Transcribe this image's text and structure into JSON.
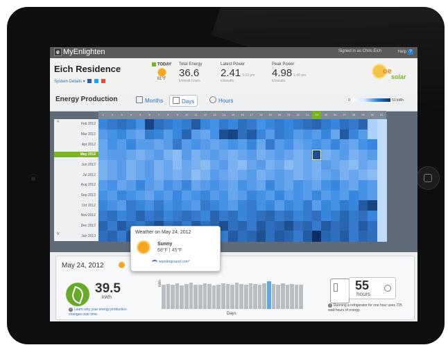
{
  "app": {
    "name": "MyEnlighten",
    "logo_glyph": "e",
    "signed_in": "Signed in as Chris Eich",
    "help_label": "Help"
  },
  "site": {
    "name": "Eich Residence",
    "details_link": "System Details"
  },
  "stats": {
    "today_label": "TODAY",
    "weather_temp": "81°F",
    "total_energy_label": "Total Energy",
    "total_energy_value": "36.6",
    "total_energy_unit": "kilowatt hours",
    "latest_power_label": "Latest Power",
    "latest_power_value": "2.41",
    "latest_power_time": "5:10 pm",
    "latest_power_unit": "kilowatts",
    "peak_power_label": "Peak Power",
    "peak_power_value": "4.98",
    "peak_power_time": "1:40 pm",
    "peak_power_unit": "kilowatts"
  },
  "brand": {
    "part1": "oe",
    "part2": "solar"
  },
  "production": {
    "title": "Energy Production",
    "tabs": [
      "Months",
      "Days",
      "Hours"
    ],
    "active_tab": 1,
    "legend_min": "0",
    "legend_max": "53 kWh",
    "colors": {
      "highlight": "#7ab51d",
      "low": "#cfe6ff",
      "high": "#0e2e63"
    }
  },
  "heatmap": {
    "days": [
      "1",
      "2",
      "3",
      "4",
      "5",
      "6",
      "7",
      "8",
      "9",
      "10",
      "11",
      "12",
      "13",
      "14",
      "15",
      "16",
      "17",
      "18",
      "19",
      "20",
      "21",
      "22",
      "23",
      "24",
      "25",
      "26",
      "27",
      "28",
      "29",
      "30",
      "31"
    ],
    "selected_day": 24,
    "months": [
      "Feb 2012",
      "Mar 2012",
      "Apr 2012",
      "May 2012",
      "Jun 2012",
      "Jul 2012",
      "Aug 2012",
      "Sep 2012",
      "Oct 2012",
      "Nov 2012",
      "Dec 2012",
      "Jan 2013"
    ],
    "selected_month": 3,
    "values": [
      [
        34,
        36,
        38,
        36,
        32,
        46,
        38,
        36,
        34,
        36,
        42,
        34,
        32,
        36,
        34,
        38,
        36,
        32,
        34,
        36,
        34,
        36,
        38,
        40,
        36,
        34,
        38,
        36,
        40,
        20,
        18
      ],
      [
        30,
        32,
        34,
        30,
        28,
        36,
        34,
        30,
        34,
        40,
        30,
        28,
        32,
        44,
        46,
        38,
        42,
        34,
        30,
        36,
        34,
        30,
        32,
        30,
        34,
        28,
        42,
        34,
        30,
        20,
        18
      ],
      [
        28,
        32,
        30,
        34,
        30,
        30,
        28,
        30,
        36,
        30,
        32,
        30,
        28,
        30,
        32,
        30,
        34,
        28,
        36,
        30,
        32,
        28,
        30,
        32,
        30,
        34,
        30,
        28,
        32,
        34,
        18
      ],
      [
        28,
        30,
        30,
        28,
        26,
        28,
        30,
        26,
        24,
        30,
        26,
        28,
        30,
        28,
        26,
        28,
        30,
        26,
        28,
        30,
        28,
        26,
        28,
        44,
        26,
        28,
        30,
        26,
        28,
        30,
        18
      ],
      [
        26,
        28,
        30,
        26,
        28,
        30,
        26,
        28,
        24,
        28,
        26,
        24,
        28,
        30,
        26,
        24,
        28,
        30,
        26,
        28,
        24,
        26,
        28,
        26,
        30,
        28,
        26,
        24,
        28,
        26,
        18
      ],
      [
        26,
        28,
        30,
        26,
        28,
        30,
        26,
        28,
        26,
        28,
        24,
        26,
        30,
        28,
        26,
        28,
        30,
        26,
        28,
        30,
        28,
        26,
        28,
        26,
        28,
        30,
        26,
        28,
        26,
        24,
        18
      ],
      [
        30,
        32,
        28,
        30,
        34,
        30,
        28,
        32,
        30,
        34,
        28,
        30,
        32,
        30,
        28,
        32,
        30,
        28,
        34,
        30,
        28,
        32,
        30,
        28,
        32,
        34,
        30,
        28,
        32,
        30,
        18
      ],
      [
        32,
        30,
        34,
        32,
        30,
        28,
        32,
        30,
        34,
        30,
        32,
        34,
        30,
        32,
        28,
        30,
        34,
        32,
        30,
        34,
        30,
        32,
        30,
        34,
        30,
        32,
        30,
        34,
        32,
        30,
        18
      ],
      [
        34,
        32,
        30,
        36,
        34,
        32,
        36,
        32,
        34,
        32,
        30,
        36,
        34,
        32,
        30,
        34,
        36,
        32,
        34,
        30,
        34,
        32,
        36,
        30,
        34,
        32,
        36,
        34,
        42,
        46,
        18
      ],
      [
        36,
        38,
        34,
        36,
        40,
        36,
        38,
        34,
        36,
        38,
        36,
        34,
        40,
        36,
        38,
        34,
        36,
        38,
        40,
        36,
        38,
        34,
        36,
        38,
        34,
        36,
        40,
        36,
        38,
        34,
        18
      ],
      [
        40,
        36,
        42,
        38,
        36,
        40,
        44,
        38,
        40,
        36,
        42,
        38,
        40,
        44,
        38,
        40,
        36,
        42,
        38,
        40,
        44,
        38,
        40,
        36,
        42,
        38,
        40,
        36,
        42,
        38,
        18
      ],
      [
        38,
        40,
        36,
        42,
        38,
        40,
        36,
        42,
        38,
        40,
        36,
        44,
        40,
        36,
        42,
        38,
        40,
        44,
        38,
        42,
        40,
        36,
        42,
        50,
        40,
        38,
        42,
        36,
        40,
        38,
        18
      ]
    ]
  },
  "weather_popup": {
    "title": "Weather on May 24, 2012",
    "condition": "Sunny",
    "temps": "68°F  |  45°F",
    "source": "wunderground.com°"
  },
  "detail": {
    "date": "May 24, 2012",
    "energy_value": "39.5",
    "energy_unit": "kWh",
    "learn_text": "Learn why your energy production changes over time.",
    "axis_y": "kWh",
    "axis_x": "Days",
    "daily_values": [
      38,
      40,
      39,
      41,
      37,
      40,
      42,
      39,
      38,
      41,
      40,
      37,
      39,
      41,
      40,
      38,
      42,
      40,
      39,
      41,
      40,
      38,
      41,
      44,
      40,
      39,
      41,
      38,
      40,
      39,
      38
    ],
    "selected_index": 23,
    "hours_value": "55",
    "hours_unit": "hours",
    "fridge_note": "Running a refrigerator for one hour uses 725 watt-hours of energy."
  }
}
